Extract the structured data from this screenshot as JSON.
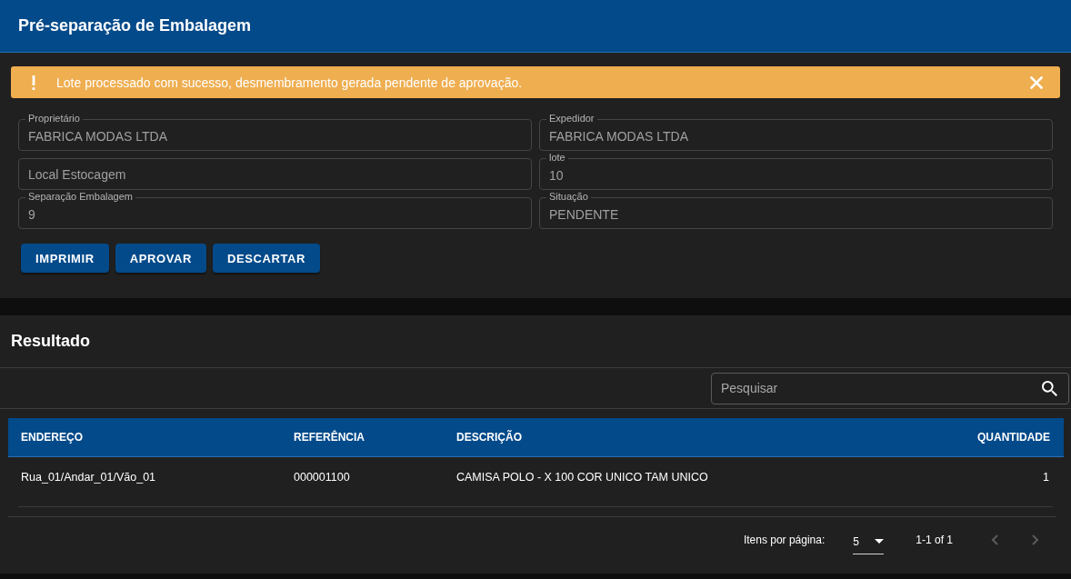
{
  "header": {
    "title": "Pré-separação de Embalagem"
  },
  "alert": {
    "kind": "warning",
    "message": "Lote processado com sucesso, desmembramento gerada pendente de aprovação."
  },
  "form": {
    "fields": [
      {
        "label": "Proprietário",
        "value": "FABRICA MODAS LTDA",
        "disabled": true
      },
      {
        "placeholder": "Local Estocagem",
        "disabled": true
      },
      {
        "label": "Separação Embalagem",
        "value": "9",
        "disabled": true
      },
      {
        "label": "Expedidor",
        "value": "FABRICA MODAS LTDA",
        "disabled": true
      },
      {
        "label": "lote",
        "value": "10",
        "disabled": true
      },
      {
        "label": "Situação",
        "value": "PENDENTE",
        "disabled": true
      }
    ],
    "buttons": [
      "IMPRIMIR",
      "APROVAR",
      "DESCARTAR"
    ]
  },
  "results": {
    "title": "Resultado",
    "search": {
      "placeholder": "Pesquisar"
    },
    "table": {
      "columns": [
        {
          "label": "ENDEREÇO",
          "kind": "text"
        },
        {
          "label": "REFERÊNCIA",
          "kind": "text"
        },
        {
          "label": "DESCRIÇÃO",
          "kind": "text"
        },
        {
          "label": "QUANTIDADE",
          "kind": "number"
        }
      ],
      "rows": [
        [
          "Rua_01/Andar_01/Vão_01",
          "000001100",
          "CAMISA POLO - X 100 COR UNICO TAM UNICO",
          "1"
        ]
      ]
    },
    "paginator": {
      "label": "Itens por página:",
      "page_size": "5",
      "range": "1-1 of 1",
      "previous": {
        "disabled": true
      },
      "next": {
        "disabled": true
      }
    }
  }
}
